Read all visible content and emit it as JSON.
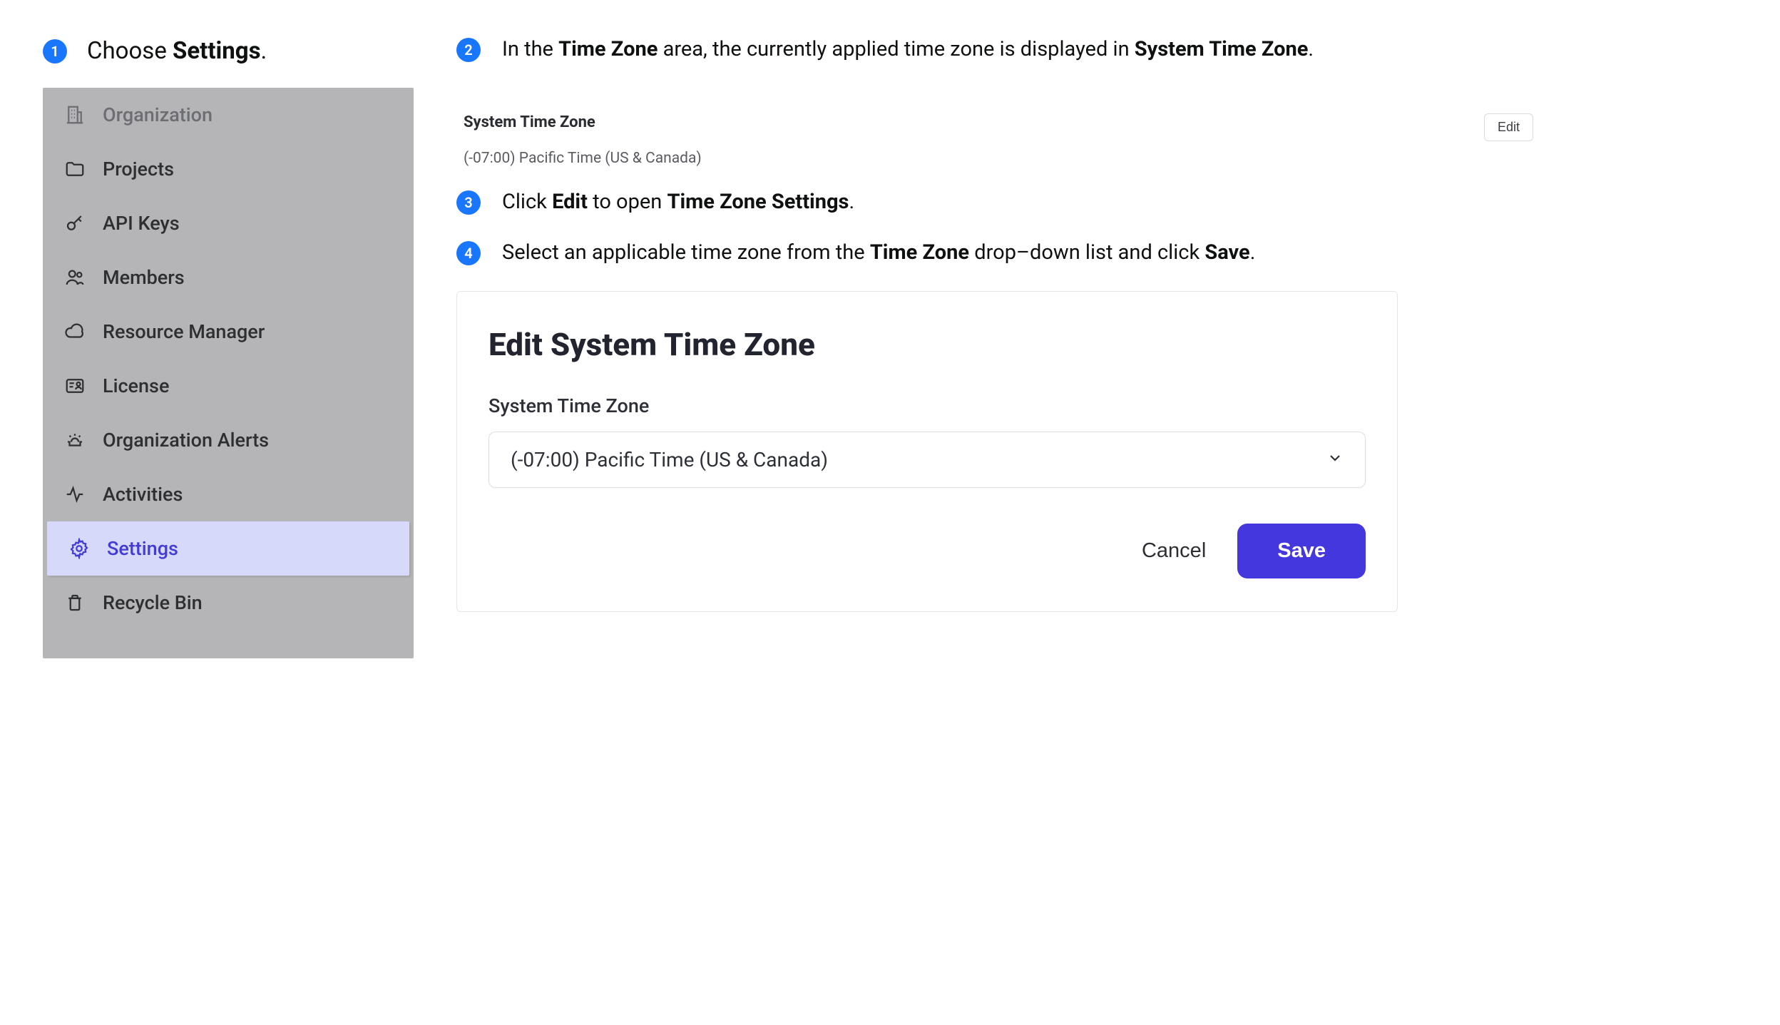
{
  "step1": {
    "num": "1",
    "prefix": "Choose ",
    "bold": "Settings",
    "suffix": "."
  },
  "sidebar": {
    "items": [
      {
        "label": "Organization",
        "icon": "building-icon",
        "muted": true
      },
      {
        "label": "Projects",
        "icon": "folder-icon"
      },
      {
        "label": "API Keys",
        "icon": "key-icon"
      },
      {
        "label": "Members",
        "icon": "people-icon"
      },
      {
        "label": "Resource Manager",
        "icon": "cloud-icon"
      },
      {
        "label": "License",
        "icon": "id-icon"
      },
      {
        "label": "Organization Alerts",
        "icon": "alert-icon"
      },
      {
        "label": "Activities",
        "icon": "activity-icon"
      },
      {
        "label": "Settings",
        "icon": "gear-icon",
        "active": true
      },
      {
        "label": "Recycle Bin",
        "icon": "trash-icon"
      }
    ]
  },
  "right": {
    "step2": {
      "num": "2",
      "t1": "In the ",
      "b1": "Time Zone",
      "t2": " area, the currently applied time zone is displayed in ",
      "b2": "System Time Zone",
      "t3": "."
    },
    "tz_label": "System Time Zone",
    "tz_value": "(-07:00) Pacific Time (US & Canada)",
    "edit_label": "Edit",
    "step3": {
      "num": "3",
      "t1": "Click ",
      "b1": "Edit",
      "t2": " to open ",
      "b2": "Time Zone Settings",
      "t3": "."
    },
    "step4": {
      "num": "4",
      "t1": "Select an applicable time zone from the ",
      "b1": "Time Zone",
      "t2": " drop–down list and click ",
      "b2": "Save",
      "t3": "."
    },
    "card": {
      "title": "Edit System Time Zone",
      "field_label": "System Time Zone",
      "select_value": "(-07:00) Pacific Time (US & Canada)",
      "cancel": "Cancel",
      "save": "Save"
    }
  }
}
